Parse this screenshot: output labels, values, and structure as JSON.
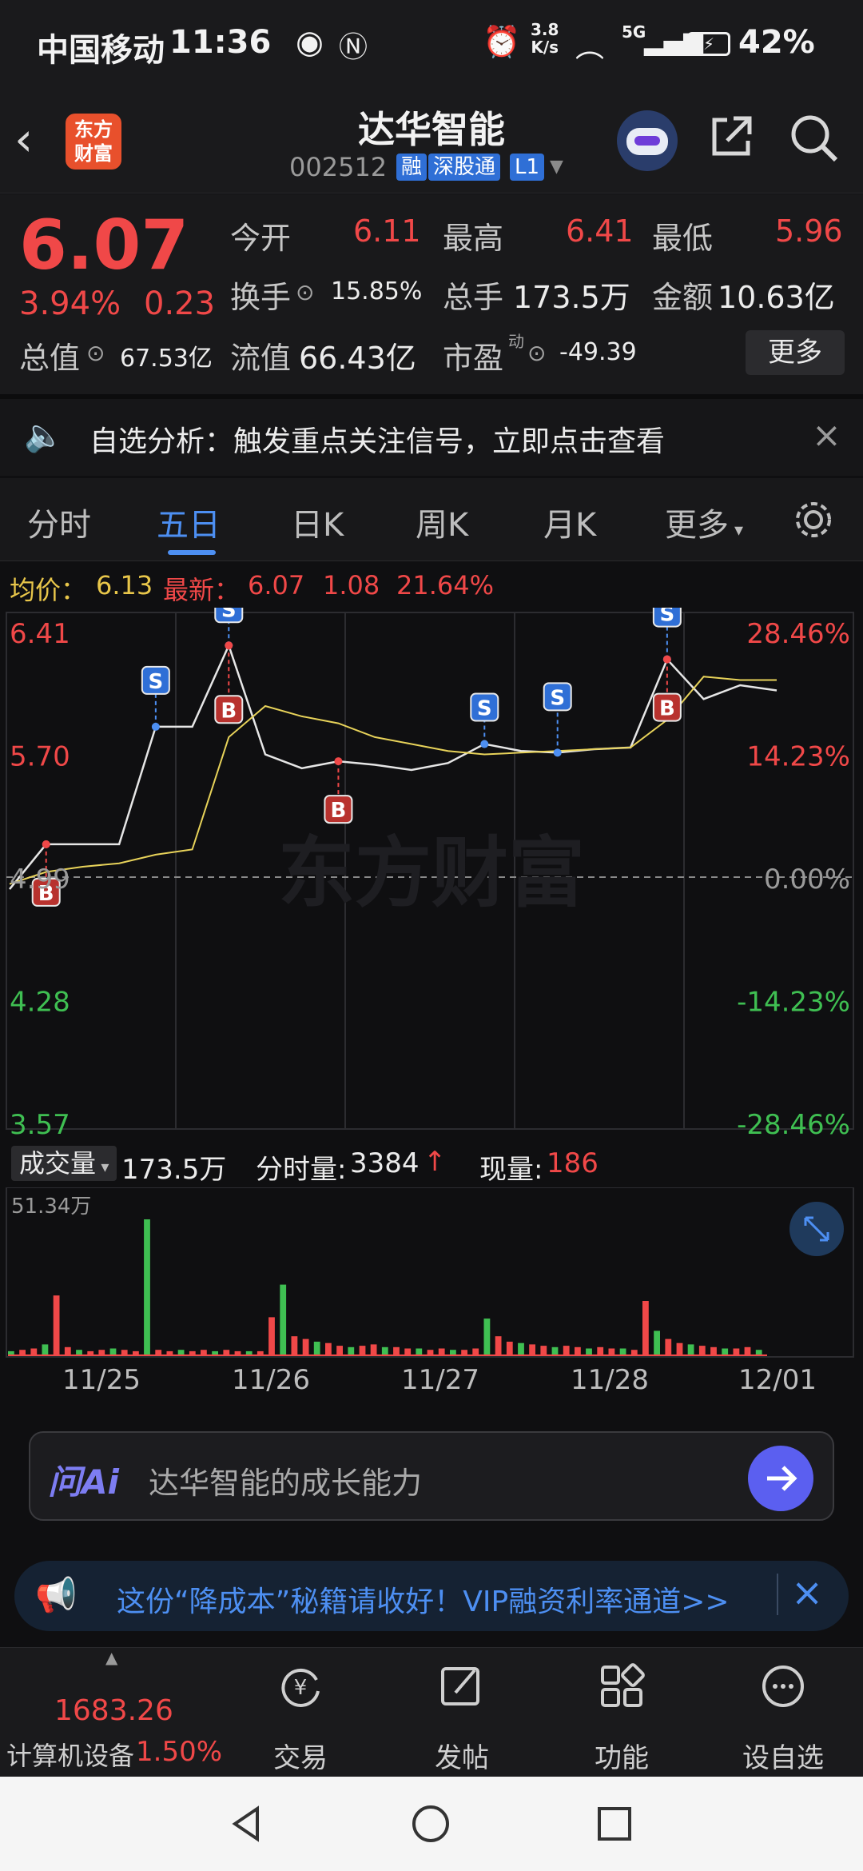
{
  "status_bar": {
    "carrier": "中国移动",
    "time": "11:36",
    "net_speed_value": "3.8",
    "net_speed_unit": "K/s",
    "signal": "5G",
    "battery": "42%"
  },
  "header": {
    "logo_line1": "东方",
    "logo_line2": "财富",
    "stock_name": "达华智能",
    "stock_code": "002512",
    "tags": [
      "融",
      "深股通",
      "L1"
    ]
  },
  "quote": {
    "price": "6.07",
    "change_pct": "3.94%",
    "change_amt": "0.23",
    "open_label": "今开",
    "open": "6.11",
    "high_label": "最高",
    "high": "6.41",
    "low_label": "最低",
    "low": "5.96",
    "turnover_label": "换手",
    "turnover": "15.85%",
    "volume_label": "总手",
    "volume": "173.5万",
    "amount_label": "金额",
    "amount": "10.63亿",
    "mktcap_label": "总值",
    "mktcap": "67.53亿",
    "float_label": "流值",
    "float": "66.43亿",
    "pe_label": "市盈",
    "pe_super": "动",
    "pe": "-49.39",
    "more": "更多"
  },
  "notice": {
    "text": "自选分析：触发重点关注信号，立即点击查看"
  },
  "tabs": [
    "分时",
    "五日",
    "日K",
    "周K",
    "月K",
    "更多"
  ],
  "active_tab": "五日",
  "chart_info": {
    "avg_label": "均价：",
    "avg": "6.13",
    "latest_label": "最新：",
    "latest": "6.07",
    "change": "1.08",
    "pct": "21.64%"
  },
  "chart_data": {
    "type": "line",
    "y_ticks_left": [
      "6.41",
      "5.70",
      "4.99",
      "4.28",
      "3.57"
    ],
    "y_ticks_right": [
      "28.46%",
      "14.23%",
      "0.00%",
      "-14.23%",
      "-28.46%"
    ],
    "ylim": [
      3.57,
      6.41
    ],
    "x": [
      "11/25",
      "11/26",
      "11/27",
      "11/28",
      "12/01"
    ],
    "series": [
      {
        "values": [
          4.92,
          5.18,
          5.18,
          5.18,
          5.86,
          5.86,
          6.33,
          5.7,
          5.62,
          5.66,
          5.64,
          5.61,
          5.65,
          5.76,
          5.72,
          5.71,
          5.73,
          5.74,
          6.25,
          6.02,
          6.1,
          6.07
        ]
      },
      {
        "values": [
          4.95,
          5.02,
          5.05,
          5.07,
          5.12,
          5.15,
          5.8,
          5.98,
          5.92,
          5.88,
          5.8,
          5.76,
          5.72,
          5.7,
          5.71,
          5.72,
          5.73,
          5.74,
          5.9,
          6.15,
          6.13,
          6.13
        ]
      }
    ],
    "markers": [
      "B",
      "S",
      "S",
      "B",
      "B",
      "S",
      "S",
      "S",
      "B"
    ],
    "watermark": "东方财富"
  },
  "volume": {
    "selector": "成交量",
    "total": "173.5万",
    "per_min_label": "分时量:",
    "per_min": "3384",
    "current_label": "现量:",
    "current": "186",
    "max_label": "51.34万",
    "bars": [
      3,
      4,
      5,
      8,
      44,
      6,
      4,
      3,
      4,
      5,
      4,
      3,
      100,
      4,
      3,
      4,
      3,
      4,
      3,
      4,
      3,
      3,
      3,
      28,
      52,
      14,
      12,
      10,
      9,
      7,
      6,
      7,
      8,
      6,
      6,
      5,
      5,
      4,
      5,
      4,
      4,
      5,
      27,
      14,
      10,
      9,
      8,
      7,
      6,
      7,
      6,
      5,
      6,
      5,
      5,
      4,
      40,
      18,
      12,
      9,
      8,
      7,
      6,
      5,
      5,
      6,
      4
    ]
  },
  "dates": [
    "11/25",
    "11/26",
    "11/27",
    "11/28",
    "12/01"
  ],
  "ai": {
    "brand": "问Ai",
    "question": "达华智能的成长能力"
  },
  "promo": {
    "text": "这份“降成本”秘籍请收好！VIP融资利率通道>>"
  },
  "bottom_nav": {
    "index_value": "1683.26",
    "index_name": "计算机设备",
    "index_pct": "1.50%",
    "items": [
      "交易",
      "发帖",
      "功能",
      "设自选"
    ]
  }
}
